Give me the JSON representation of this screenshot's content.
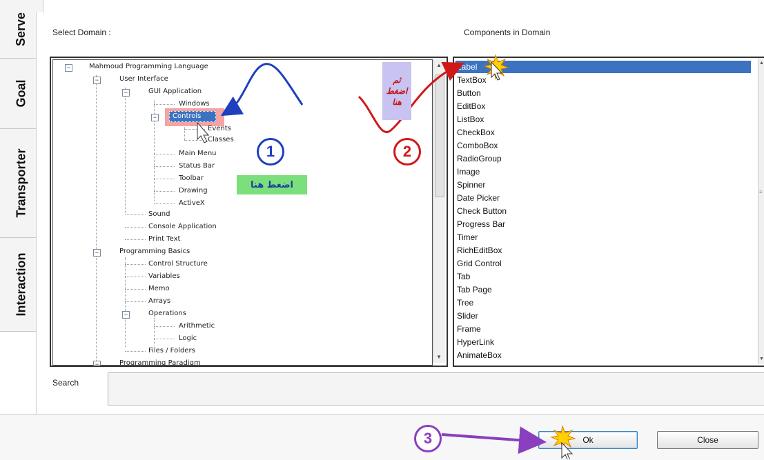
{
  "side_tabs": [
    "Serve",
    "Goal",
    "Transporter",
    "Interaction"
  ],
  "labels": {
    "select_domain": "Select Domain :",
    "components": "Components in Domain",
    "search": "Search"
  },
  "tree": {
    "root": "Mahmoud Programming Language",
    "user_interface": "User Interface",
    "gui_application": "GUI Application",
    "windows": "Windows",
    "controls": "Controls",
    "events": "Events",
    "classes": "Classes",
    "main_menu": "Main Menu",
    "status_bar": "Status Bar",
    "toolbar": "Toolbar",
    "drawing": "Drawing",
    "activex": "ActiveX",
    "sound": "Sound",
    "console_application": "Console Application",
    "print_text": "Print Text",
    "programming_basics": "Programming Basics",
    "control_structure": "Control Structure",
    "variables": "Variables",
    "memo": "Memo",
    "arrays": "Arrays",
    "operations": "Operations",
    "arithmetic": "Arithmetic",
    "logic": "Logic",
    "files_folders": "Files / Folders",
    "programming_paradigm": "Programming Paradigm"
  },
  "components": [
    "Label",
    "TextBox",
    "Button",
    "EditBox",
    "ListBox",
    "CheckBox",
    "ComboBox",
    "RadioGroup",
    "Image",
    "Spinner",
    "Date Picker",
    "Check Button",
    "Progress Bar",
    "Timer",
    "RichEditBox",
    "Grid Control",
    "Tab",
    "Tab Page",
    "Tree",
    "Slider",
    "Frame",
    "HyperLink",
    "AnimateBox"
  ],
  "buttons": {
    "ok": "Ok",
    "close": "Close"
  },
  "annotations": {
    "step1": "1",
    "step2": "2",
    "step3": "3",
    "press_here": "اضغط هنا",
    "then_press_here_1": "ثم",
    "then_press_here_2": "اضغط",
    "then_press_here_3": "هنا"
  },
  "colors": {
    "selection": "#3b73c0",
    "step1": "#1f3fbf",
    "step2": "#d01818",
    "step3": "#8a3fbf",
    "green_note_bg": "#7be07b",
    "purple_note_bg": "#c9c3f1"
  }
}
